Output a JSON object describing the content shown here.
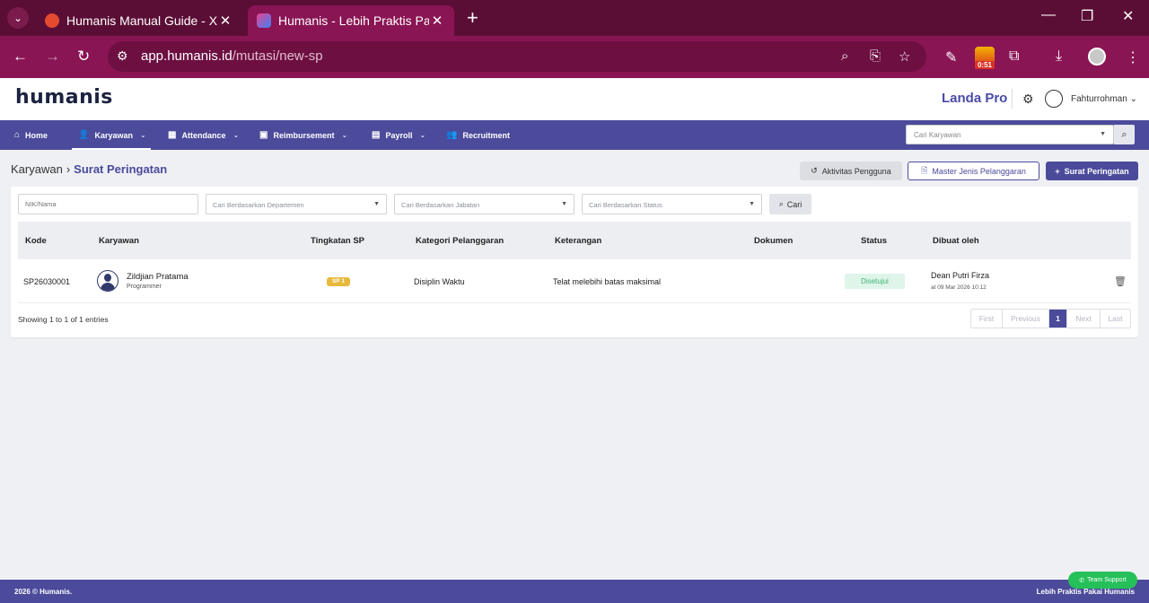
{
  "browser": {
    "tabs": [
      {
        "title": "Humanis Manual Guide - Xmind"
      },
      {
        "title": "Humanis - Lebih Praktis Pakai Humanis"
      }
    ],
    "url_host": "app.humanis.id",
    "url_path": "/mutasi/new-sp",
    "timer_badge": "0:51"
  },
  "header": {
    "logo": "humanis",
    "company": "Landa Pro",
    "user": "Fahturrohman"
  },
  "nav": {
    "items": [
      {
        "label": "Home"
      },
      {
        "label": "Karyawan"
      },
      {
        "label": "Attendance"
      },
      {
        "label": "Reimbursement"
      },
      {
        "label": "Payroll"
      },
      {
        "label": "Recruitment"
      }
    ],
    "search_placeholder": "Cari Karyawan"
  },
  "breadcrumb": {
    "parent": "Karyawan",
    "current": "Surat Peringatan"
  },
  "actions": {
    "activity": "Aktivitas Pengguna",
    "master": "Master Jenis Pelanggaran",
    "add": "Surat Peringatan"
  },
  "filters": {
    "nik_placeholder": "NIK/Nama",
    "department": "Cari Berdasarkan Departemen",
    "position": "Cari Berdasarkan Jabatan",
    "status": "Cari Berdasarkan Status",
    "search_button": "Cari"
  },
  "table": {
    "columns": [
      "Kode",
      "Karyawan",
      "Tingkatan SP",
      "Kategori Pelanggaran",
      "Keterangan",
      "Dokumen",
      "Status",
      "Dibuat oleh"
    ],
    "rows": [
      {
        "kode": "SP26030001",
        "employee_name": "Zildjian Pratama",
        "employee_role": "Programmer",
        "level": "SP 1",
        "category": "Disiplin Waktu",
        "description": "Telat melebihi batas maksimal",
        "status": "Disetujui",
        "created_by": "Dean Putri Firza",
        "created_at": "at 09 Mar 2026 10:12"
      }
    ]
  },
  "pagination": {
    "summary": "Showing 1 to 1 of 1 entries",
    "first": "First",
    "previous": "Previous",
    "current": "1",
    "next": "Next",
    "last": "Last"
  },
  "footer": {
    "copyright": "2026 © Humanis.",
    "tagline": "Lebih Praktis Pakai Humanis",
    "support": "Team Support"
  },
  "colors": {
    "brand": "#4b4a9b",
    "browser_frame": "#8a1554",
    "status_approved": "#3cb371",
    "sp_badge": "#e7b93d"
  }
}
